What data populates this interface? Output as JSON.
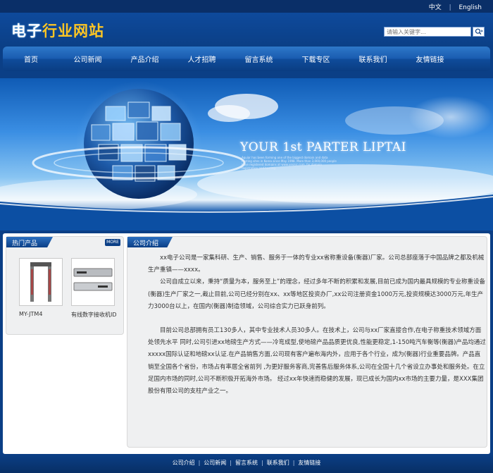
{
  "top": {
    "lang_cn": "中文",
    "separator": "|",
    "lang_en": "English"
  },
  "logo": {
    "part1": "电子",
    "part2": "行业网站"
  },
  "search": {
    "placeholder": "请输入关键字..."
  },
  "nav": {
    "items": [
      "首页",
      "公司新闻",
      "产品介绍",
      "人才招聘",
      "留言系统",
      "下载专区",
      "联系我们",
      "友情链接"
    ]
  },
  "banner": {
    "headline": "YOUR 1st PARTER LIPTAI",
    "small_text": "Aquiar has been forming one of the biggest domain and data hosting sites in Korea since May 1998. More than 3,000,000 people have registered domains at www.yesnic.com, for domain registration and hosting."
  },
  "hot_products": {
    "title": "热门产品",
    "more": "MORE",
    "items": [
      {
        "name": "MY-JTM4"
      },
      {
        "name": "有线数字接收机ID"
      }
    ]
  },
  "about": {
    "title": "公司介绍",
    "paragraphs": [
      "xx电子公司是一家集科研、生产、销售、服务于一体的专业xx省称重设备(衡器)厂家。公司总部座落于中国品牌之都及机械生产重镇——xxxx。",
      "公司自成立以来，秉持“质量为本，服务至上”的理念，经过多年不断的积累和发展,目前已成为国内最具规模的专业称重设备(衡器)生产厂家之一,截止目前,公司已经分别在xx、xx等地区投资办厂,xx公司注册资金1000万元,投资规模达3000万元,年生产力3000台以上，在国内(衡器)制造领域，公司综合实力已跃身前列。",
      "目前公司总部拥有员工130多人，其中专业技术人员30多人。在技术上，公司与xx厂家直接合作,在电子称重技术领域方面处领先水平 同时,公司引进xx地磅生产方式——冷弯成型,使地磅产品品质更优良,性能更稳定,1-150吨汽车衡等(衡器)产品均通过xxxxx国际认证和地磅xx认证.在产品销售方面,公司现有客户遍布海内外，应用于各个行业，成为(衡器)行业重要品牌。产品直销至全国各个省份，市场占有率居全省前列 ,为更好服务客商,完善售后服务体系,公司在全国十几个省设立办事处和服务处。在立足国内市场的同时,公司不断积极开拓海外市场。 经过xx年快速而稳健的发展，现已成长为国内xx市场的主要力量，是XXX集团股份有限公司的支柱产业之一。"
    ]
  },
  "footer": {
    "links": [
      "公司介绍",
      "公司新闻",
      "留言系统",
      "联系我们",
      "友情链接"
    ],
    "separator": "|"
  }
}
